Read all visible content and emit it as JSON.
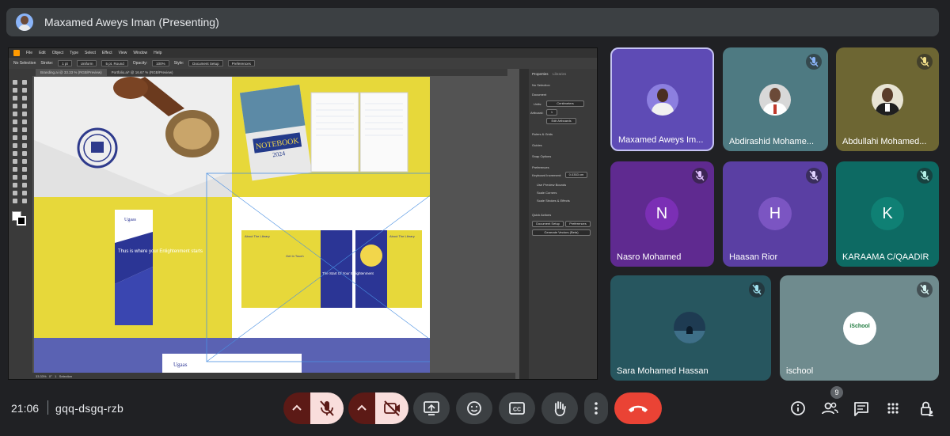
{
  "presenter": {
    "name": "Maxamed Aweys Iman (Presenting)"
  },
  "shared_screen": {
    "app_name": "Adobe Illustrator",
    "menu": [
      "File",
      "Edit",
      "Object",
      "Type",
      "Select",
      "Effect",
      "View",
      "Window",
      "Help"
    ],
    "control_bar": {
      "selection": "No Selection",
      "stroke_label": "Stroke:",
      "stroke_value": "1 pt",
      "uniform": "Uniform",
      "brush": "5 pt. Round",
      "opacity_label": "Opacity:",
      "opacity_value": "100%",
      "style_label": "Style:",
      "doc_setup": "Document Setup",
      "preferences": "Preferences"
    },
    "tabs": [
      "Branding.ai @ 33.33 % (RGB/Preview)",
      "Portfolio.ai* @ 16.67 % (RGB/Preview)"
    ],
    "status": {
      "zoom": "33.33%",
      "rotation": "0°",
      "artboard": "1",
      "mode": "Selection"
    },
    "panel": {
      "tabs": [
        "Properties",
        "Libraries"
      ],
      "no_selection": "No Selection",
      "document": "Document",
      "units_label": "Units:",
      "units_value": "Centimeters",
      "artboard_label": "Artboard:",
      "artboard_value": "1",
      "edit_artboards": "Edit Artboards",
      "rulers": "Rulers & Grids",
      "guides": "Guides",
      "snap": "Snap Options",
      "preferences_head": "Preferences",
      "keyboard_increment_label": "Keyboard Increment:",
      "keyboard_increment_value": "0.0353 cm",
      "opt1": "Use Preview Bounds",
      "opt2": "Scale Corners",
      "opt3": "Scale Strokes & Effects",
      "quick_actions": "Quick Actions",
      "qa_doc_setup": "Document Setup",
      "qa_prefs": "Preferences",
      "qa_vectors": "Generate Vectors (Beta)"
    },
    "artwork": {
      "notebook_title": "NOTEBOOK",
      "notebook_year": "2024",
      "brand": "Ugaas",
      "brand_sub": "Library",
      "banner_text": "Thus is where your Enlightenment starts",
      "brochure_left": "About The Library",
      "brochure_mid_1": "Get In Touch",
      "brochure_center": "The Start Of Your Enlightenment",
      "brochure_right": "About The Library"
    }
  },
  "participants": [
    {
      "name": "Maxamed Aweys Im...",
      "bg": "#5e4bb5",
      "type": "photo",
      "active": true,
      "muted": false
    },
    {
      "name": "Abdirashid Mohame...",
      "bg": "#4e7a82",
      "type": "photo",
      "active": false,
      "muted": true
    },
    {
      "name": "Abdullahi Mohamed...",
      "bg": "#6d6633",
      "type": "photo",
      "active": false,
      "muted": true
    },
    {
      "name": "Nasro Mohamed",
      "bg": "#5f2a90",
      "type": "letter",
      "letter": "N",
      "letter_bg": "#7b2fb5",
      "muted": true
    },
    {
      "name": "Haasan Rior",
      "bg": "#5a3fa3",
      "type": "letter",
      "letter": "H",
      "letter_bg": "#7b55c2",
      "muted": true
    },
    {
      "name": "KARAAMA C/QAADIR",
      "bg": "#0d6a63",
      "type": "letter",
      "letter": "K",
      "letter_bg": "#0f8074",
      "muted": true
    },
    {
      "name": "Sara Mohamed Hassan",
      "bg": "#27565f",
      "type": "photo",
      "muted": true
    },
    {
      "name": "ischool",
      "bg": "#6f8b8e",
      "type": "logo",
      "logo_text": "iSchool",
      "muted": true
    }
  ],
  "bottom_bar": {
    "time": "21:06",
    "meeting_code": "gqq-dsgq-rzb",
    "people_count": "9"
  },
  "colors": {
    "background": "#202124",
    "danger": "#ea4335",
    "muted_btn": "#f9dedc"
  }
}
